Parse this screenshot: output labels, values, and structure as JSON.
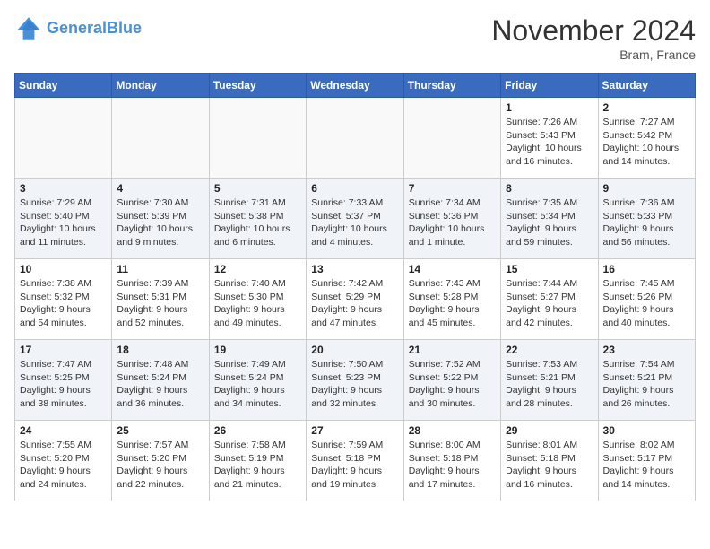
{
  "header": {
    "logo_line1": "General",
    "logo_line2": "Blue",
    "month": "November 2024",
    "location": "Bram, France"
  },
  "weekdays": [
    "Sunday",
    "Monday",
    "Tuesday",
    "Wednesday",
    "Thursday",
    "Friday",
    "Saturday"
  ],
  "weeks": [
    [
      {
        "day": "",
        "info": ""
      },
      {
        "day": "",
        "info": ""
      },
      {
        "day": "",
        "info": ""
      },
      {
        "day": "",
        "info": ""
      },
      {
        "day": "",
        "info": ""
      },
      {
        "day": "1",
        "info": "Sunrise: 7:26 AM\nSunset: 5:43 PM\nDaylight: 10 hours and 16 minutes."
      },
      {
        "day": "2",
        "info": "Sunrise: 7:27 AM\nSunset: 5:42 PM\nDaylight: 10 hours and 14 minutes."
      }
    ],
    [
      {
        "day": "3",
        "info": "Sunrise: 7:29 AM\nSunset: 5:40 PM\nDaylight: 10 hours and 11 minutes."
      },
      {
        "day": "4",
        "info": "Sunrise: 7:30 AM\nSunset: 5:39 PM\nDaylight: 10 hours and 9 minutes."
      },
      {
        "day": "5",
        "info": "Sunrise: 7:31 AM\nSunset: 5:38 PM\nDaylight: 10 hours and 6 minutes."
      },
      {
        "day": "6",
        "info": "Sunrise: 7:33 AM\nSunset: 5:37 PM\nDaylight: 10 hours and 4 minutes."
      },
      {
        "day": "7",
        "info": "Sunrise: 7:34 AM\nSunset: 5:36 PM\nDaylight: 10 hours and 1 minute."
      },
      {
        "day": "8",
        "info": "Sunrise: 7:35 AM\nSunset: 5:34 PM\nDaylight: 9 hours and 59 minutes."
      },
      {
        "day": "9",
        "info": "Sunrise: 7:36 AM\nSunset: 5:33 PM\nDaylight: 9 hours and 56 minutes."
      }
    ],
    [
      {
        "day": "10",
        "info": "Sunrise: 7:38 AM\nSunset: 5:32 PM\nDaylight: 9 hours and 54 minutes."
      },
      {
        "day": "11",
        "info": "Sunrise: 7:39 AM\nSunset: 5:31 PM\nDaylight: 9 hours and 52 minutes."
      },
      {
        "day": "12",
        "info": "Sunrise: 7:40 AM\nSunset: 5:30 PM\nDaylight: 9 hours and 49 minutes."
      },
      {
        "day": "13",
        "info": "Sunrise: 7:42 AM\nSunset: 5:29 PM\nDaylight: 9 hours and 47 minutes."
      },
      {
        "day": "14",
        "info": "Sunrise: 7:43 AM\nSunset: 5:28 PM\nDaylight: 9 hours and 45 minutes."
      },
      {
        "day": "15",
        "info": "Sunrise: 7:44 AM\nSunset: 5:27 PM\nDaylight: 9 hours and 42 minutes."
      },
      {
        "day": "16",
        "info": "Sunrise: 7:45 AM\nSunset: 5:26 PM\nDaylight: 9 hours and 40 minutes."
      }
    ],
    [
      {
        "day": "17",
        "info": "Sunrise: 7:47 AM\nSunset: 5:25 PM\nDaylight: 9 hours and 38 minutes."
      },
      {
        "day": "18",
        "info": "Sunrise: 7:48 AM\nSunset: 5:24 PM\nDaylight: 9 hours and 36 minutes."
      },
      {
        "day": "19",
        "info": "Sunrise: 7:49 AM\nSunset: 5:24 PM\nDaylight: 9 hours and 34 minutes."
      },
      {
        "day": "20",
        "info": "Sunrise: 7:50 AM\nSunset: 5:23 PM\nDaylight: 9 hours and 32 minutes."
      },
      {
        "day": "21",
        "info": "Sunrise: 7:52 AM\nSunset: 5:22 PM\nDaylight: 9 hours and 30 minutes."
      },
      {
        "day": "22",
        "info": "Sunrise: 7:53 AM\nSunset: 5:21 PM\nDaylight: 9 hours and 28 minutes."
      },
      {
        "day": "23",
        "info": "Sunrise: 7:54 AM\nSunset: 5:21 PM\nDaylight: 9 hours and 26 minutes."
      }
    ],
    [
      {
        "day": "24",
        "info": "Sunrise: 7:55 AM\nSunset: 5:20 PM\nDaylight: 9 hours and 24 minutes."
      },
      {
        "day": "25",
        "info": "Sunrise: 7:57 AM\nSunset: 5:20 PM\nDaylight: 9 hours and 22 minutes."
      },
      {
        "day": "26",
        "info": "Sunrise: 7:58 AM\nSunset: 5:19 PM\nDaylight: 9 hours and 21 minutes."
      },
      {
        "day": "27",
        "info": "Sunrise: 7:59 AM\nSunset: 5:18 PM\nDaylight: 9 hours and 19 minutes."
      },
      {
        "day": "28",
        "info": "Sunrise: 8:00 AM\nSunset: 5:18 PM\nDaylight: 9 hours and 17 minutes."
      },
      {
        "day": "29",
        "info": "Sunrise: 8:01 AM\nSunset: 5:18 PM\nDaylight: 9 hours and 16 minutes."
      },
      {
        "day": "30",
        "info": "Sunrise: 8:02 AM\nSunset: 5:17 PM\nDaylight: 9 hours and 14 minutes."
      }
    ]
  ]
}
